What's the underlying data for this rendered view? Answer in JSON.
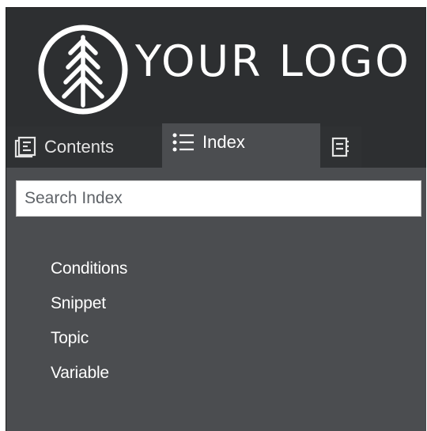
{
  "logo": {
    "text": "YOUR LOGO",
    "icon": "tree-logo-icon",
    "color": "#ffffff"
  },
  "tabs": [
    {
      "label": "Contents",
      "icon": "toc-book-icon",
      "selected": false
    },
    {
      "label": "Index",
      "icon": "list-icon",
      "selected": true
    },
    {
      "label": "",
      "icon": "glossary-icon",
      "selected": false
    }
  ],
  "search": {
    "placeholder": "Search Index",
    "value": ""
  },
  "index_terms": [
    "Conditions",
    "Snippet",
    "Topic",
    "Variable"
  ],
  "colors": {
    "header_bg": "#2d2f31",
    "panel_bg": "#4b4d50",
    "selected_tab_bg": "#4b4d50",
    "text": "#ffffff"
  }
}
